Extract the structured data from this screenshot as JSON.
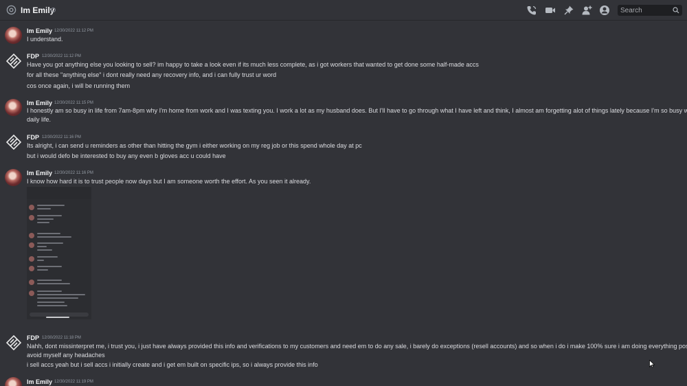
{
  "header": {
    "channel_title": "Im Emily",
    "search_placeholder": "Search",
    "icons": [
      "at-icon",
      "voice-call-icon",
      "video-call-icon",
      "pinned-messages-icon",
      "add-friends-icon",
      "user-profile-icon",
      "search-icon"
    ]
  },
  "messages": [
    {
      "author": "Im Emily",
      "timestamp": "12/30/2022 11:12 PM",
      "lines": [
        "I understand."
      ]
    },
    {
      "author": "FDP",
      "timestamp": "12/30/2022 11:12 PM",
      "lines": [
        "Have you got anything else you looking to sell? im happy to take a look even if its much less complete, as i got workers that wanted to get done some half-made accs",
        "for all these \"anything else\" i dont really need any recovery info, and i can fully trust ur word",
        "cos once again, i will be running them"
      ]
    },
    {
      "author": "Im Emily",
      "timestamp": "12/30/2022 11:15 PM",
      "lines": [
        "I honestly am so busy in life from 7am-8pm why I'm home from work and I was texting you. I work a lot as my husband does. But I'll have to go through what I have left and think, I almost am forgetting alot of things lately because I'm so busy with my",
        "daily life."
      ]
    },
    {
      "author": "FDP",
      "timestamp": "12/30/2022 11:16 PM",
      "lines": [
        "Its alright, i can send u reminders as other than hitting the gym i either working  on my reg job or this spend whole day at pc",
        "but i would defo be interested to buy any even b gloves acc u could have"
      ]
    },
    {
      "author": "Im Emily",
      "timestamp": "12/30/2022 11:16 PM",
      "lines": [
        "I know how hard it is to trust people now days but I am someone worth the effort. As you seen it already."
      ]
    },
    {
      "author": "FDP",
      "timestamp": "12/30/2022 11:18 PM",
      "lines": [
        "Nahh, dont missinterpret me, i trust you, i just have always provided this info and verifications to my customers and need em to do any sale, i barely do exceptions (resell accounts) and so when i do i make 100% sure i am doing everything possible to",
        "avoid myself any headaches",
        "i sell accs yeah but i sell accs i initially create and i get em built on specific ips, so i always provide this info"
      ]
    },
    {
      "author": "Im Emily",
      "timestamp": "12/30/2022 11:19 PM",
      "lines": []
    }
  ]
}
